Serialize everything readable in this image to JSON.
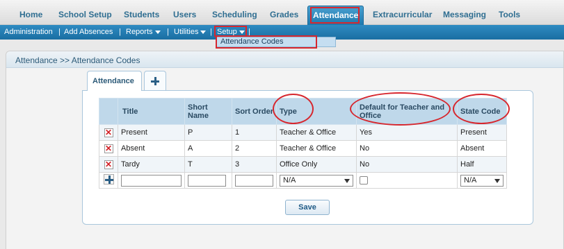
{
  "top_nav": {
    "tabs": [
      {
        "label": "Home"
      },
      {
        "label": "School Setup"
      },
      {
        "label": "Students"
      },
      {
        "label": "Users"
      },
      {
        "label": "Scheduling"
      },
      {
        "label": "Grades"
      },
      {
        "label": "Attendance",
        "active": true
      },
      {
        "label": "Extracurricular"
      },
      {
        "label": "Messaging"
      },
      {
        "label": "Tools"
      }
    ]
  },
  "sub_nav": {
    "items": [
      {
        "label": "Administration"
      },
      {
        "label": "Add Absences"
      },
      {
        "label": "Reports"
      },
      {
        "label": "Utilities"
      },
      {
        "label": "Setup"
      }
    ],
    "separator": "|"
  },
  "setup_dropdown": {
    "options": [
      "Attendance Codes"
    ]
  },
  "breadcrumb": "Attendance >> Attendance Codes",
  "inner_tabs": {
    "active_label": "Attendance"
  },
  "table": {
    "headers": {
      "title": "Title",
      "short_name": "Short Name",
      "sort_order": "Sort Order",
      "type": "Type",
      "default": "Default for Teacher and Office",
      "state_code": "State Code"
    },
    "rows": [
      {
        "title": "Present",
        "short_name": "P",
        "sort_order": "1",
        "type": "Teacher & Office",
        "default": "Yes",
        "state_code": "Present"
      },
      {
        "title": "Absent",
        "short_name": "A",
        "sort_order": "2",
        "type": "Teacher & Office",
        "default": "No",
        "state_code": "Absent"
      },
      {
        "title": "Tardy",
        "short_name": "T",
        "sort_order": "3",
        "type": "Office Only",
        "default": "No",
        "state_code": "Half"
      }
    ],
    "new_row": {
      "type_selected": "N/A",
      "state_code_selected": "N/A",
      "default_checked": false
    }
  },
  "save_label": "Save",
  "icons": {
    "delete": "x-icon",
    "add": "plus-icon"
  },
  "colors": {
    "accent": "#1e78ad",
    "highlight": "#d7262d",
    "header_bg": "#bfd8ea"
  }
}
